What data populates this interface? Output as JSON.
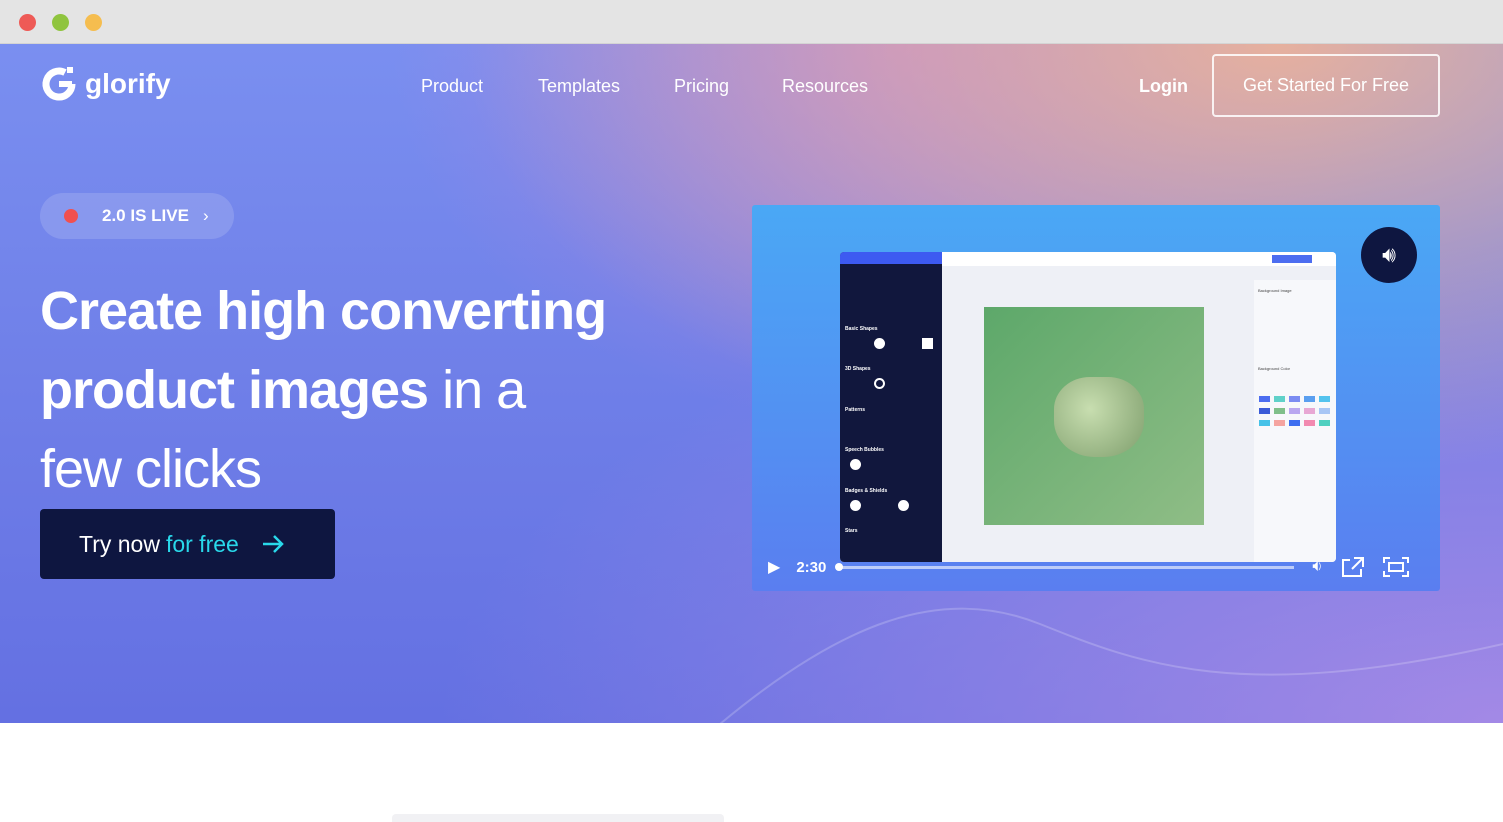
{
  "window": {
    "controls": [
      "close",
      "minimize",
      "maximize"
    ]
  },
  "header": {
    "logo": "glorify",
    "nav": [
      {
        "label": "Product"
      },
      {
        "label": "Templates"
      },
      {
        "label": "Pricing"
      },
      {
        "label": "Resources"
      }
    ],
    "login": "Login",
    "cta": "Get Started For Free"
  },
  "hero": {
    "badge": "2.0 IS LIVE",
    "title_bold_1": "Create high converting",
    "title_bold_2": "product images",
    "title_light_1": " in a",
    "title_light_2": "few clicks",
    "try_label": "Try now",
    "try_accent": "for free"
  },
  "video": {
    "time": "2:30",
    "progress_percent": 0,
    "app": {
      "sections": [
        "Basic Shapes",
        "3D Shapes",
        "Patterns",
        "Speech Bubbles",
        "Badges & Shields",
        "Stars"
      ],
      "panel": [
        "Background Image",
        "Background Color"
      ]
    }
  },
  "colors": {
    "accent": "#29d8ea",
    "dark": "#0e1640"
  }
}
